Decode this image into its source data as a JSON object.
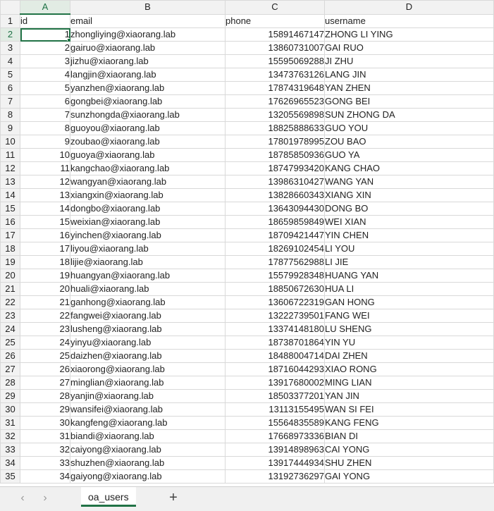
{
  "columns": [
    "A",
    "B",
    "C",
    "D"
  ],
  "headers": [
    "id",
    "email",
    "phone",
    "username"
  ],
  "rows": [
    [
      "1",
      "zhongliying@xiaorang.lab",
      "15891467147",
      "ZHONG LI YING"
    ],
    [
      "2",
      "gairuo@xiaorang.lab",
      "13860731007",
      "GAI RUO"
    ],
    [
      "3",
      "jizhu@xiaorang.lab",
      "15595069288",
      "JI ZHU"
    ],
    [
      "4",
      "langjin@xiaorang.lab",
      "13473763126",
      "LANG JIN"
    ],
    [
      "5",
      "yanzhen@xiaorang.lab",
      "17874319648",
      "YAN ZHEN"
    ],
    [
      "6",
      "gongbei@xiaorang.lab",
      "17626965523",
      "GONG BEI"
    ],
    [
      "7",
      "sunzhongda@xiaorang.lab",
      "13205569898",
      "SUN ZHONG DA"
    ],
    [
      "8",
      "guoyou@xiaorang.lab",
      "18825888633",
      "GUO YOU"
    ],
    [
      "9",
      "zoubao@xiaorang.lab",
      "17801978995",
      "ZOU BAO"
    ],
    [
      "10",
      "guoya@xiaorang.lab",
      "18785850936",
      "GUO YA"
    ],
    [
      "11",
      "kangchao@xiaorang.lab",
      "18747993420",
      "KANG CHAO"
    ],
    [
      "12",
      "wangyan@xiaorang.lab",
      "13986310427",
      "WANG YAN"
    ],
    [
      "13",
      "xiangxin@xiaorang.lab",
      "13828660343",
      "XIANG XIN"
    ],
    [
      "14",
      "dongbo@xiaorang.lab",
      "13643094430",
      "DONG BO"
    ],
    [
      "15",
      "weixian@xiaorang.lab",
      "18659859849",
      "WEI XIAN"
    ],
    [
      "16",
      "yinchen@xiaorang.lab",
      "18709421447",
      "YIN CHEN"
    ],
    [
      "17",
      "liyou@xiaorang.lab",
      "18269102454",
      "LI YOU"
    ],
    [
      "18",
      "lijie@xiaorang.lab",
      "17877562988",
      "LI JIE"
    ],
    [
      "19",
      "huangyan@xiaorang.lab",
      "15579928348",
      "HUANG YAN"
    ],
    [
      "20",
      "huali@xiaorang.lab",
      "18850672630",
      "HUA LI"
    ],
    [
      "21",
      "ganhong@xiaorang.lab",
      "13606722319",
      "GAN HONG"
    ],
    [
      "22",
      "fangwei@xiaorang.lab",
      "13222739501",
      "FANG WEI"
    ],
    [
      "23",
      "lusheng@xiaorang.lab",
      "13374148180",
      "LU SHENG"
    ],
    [
      "24",
      "yinyu@xiaorang.lab",
      "18738701864",
      "YIN YU"
    ],
    [
      "25",
      "daizhen@xiaorang.lab",
      "18488004714",
      "DAI ZHEN"
    ],
    [
      "26",
      "xiaorong@xiaorang.lab",
      "18716044293",
      "XIAO RONG"
    ],
    [
      "27",
      "minglian@xiaorang.lab",
      "13917680002",
      "MING LIAN"
    ],
    [
      "28",
      "yanjin@xiaorang.lab",
      "18503377201",
      "YAN JIN"
    ],
    [
      "29",
      "wansifei@xiaorang.lab",
      "13113155495",
      "WAN SI FEI"
    ],
    [
      "30",
      "kangfeng@xiaorang.lab",
      "15564835589",
      "KANG FENG"
    ],
    [
      "31",
      "biandi@xiaorang.lab",
      "17668973336",
      "BIAN DI"
    ],
    [
      "32",
      "caiyong@xiaorang.lab",
      "13914898963",
      "CAI YONG"
    ],
    [
      "33",
      "shuzhen@xiaorang.lab",
      "13917444934",
      "SHU ZHEN"
    ],
    [
      "34",
      "gaiyong@xiaorang.lab",
      "13192736297",
      "GAI YONG"
    ]
  ],
  "active_cell": "A2",
  "sheet_tabs": [
    "oa_users"
  ],
  "nav": {
    "prev_icon": "chevron-left-icon",
    "next_icon": "chevron-right-icon",
    "add_label": "+"
  },
  "colors": {
    "accent": "#217346",
    "header_bg": "#f2f2f2",
    "grid": "#d9d9d9"
  }
}
